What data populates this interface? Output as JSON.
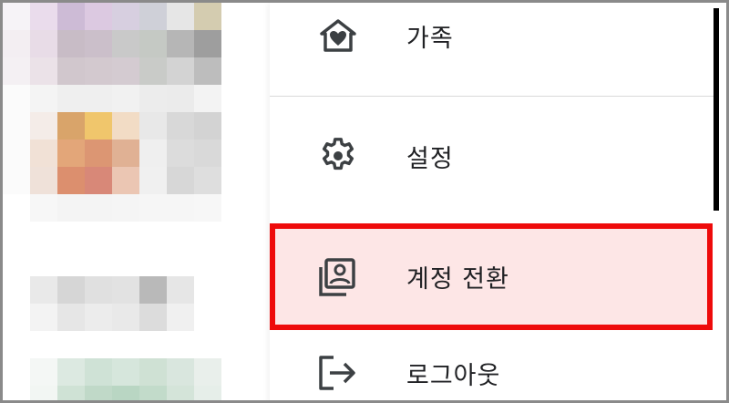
{
  "menu": {
    "items": [
      {
        "id": "family",
        "label": "가족",
        "icon": "home-heart-icon"
      },
      {
        "id": "settings",
        "label": "설정",
        "icon": "gear-icon"
      },
      {
        "id": "switch_account",
        "label": "계정 전환",
        "icon": "switch-account-icon",
        "highlighted": true
      },
      {
        "id": "logout",
        "label": "로그아웃",
        "icon": "logout-icon"
      }
    ]
  },
  "colors": {
    "highlight_border": "#ee0b0b",
    "highlight_fill": "#fde6e6",
    "icon": "#3c4043",
    "text": "#202124"
  }
}
